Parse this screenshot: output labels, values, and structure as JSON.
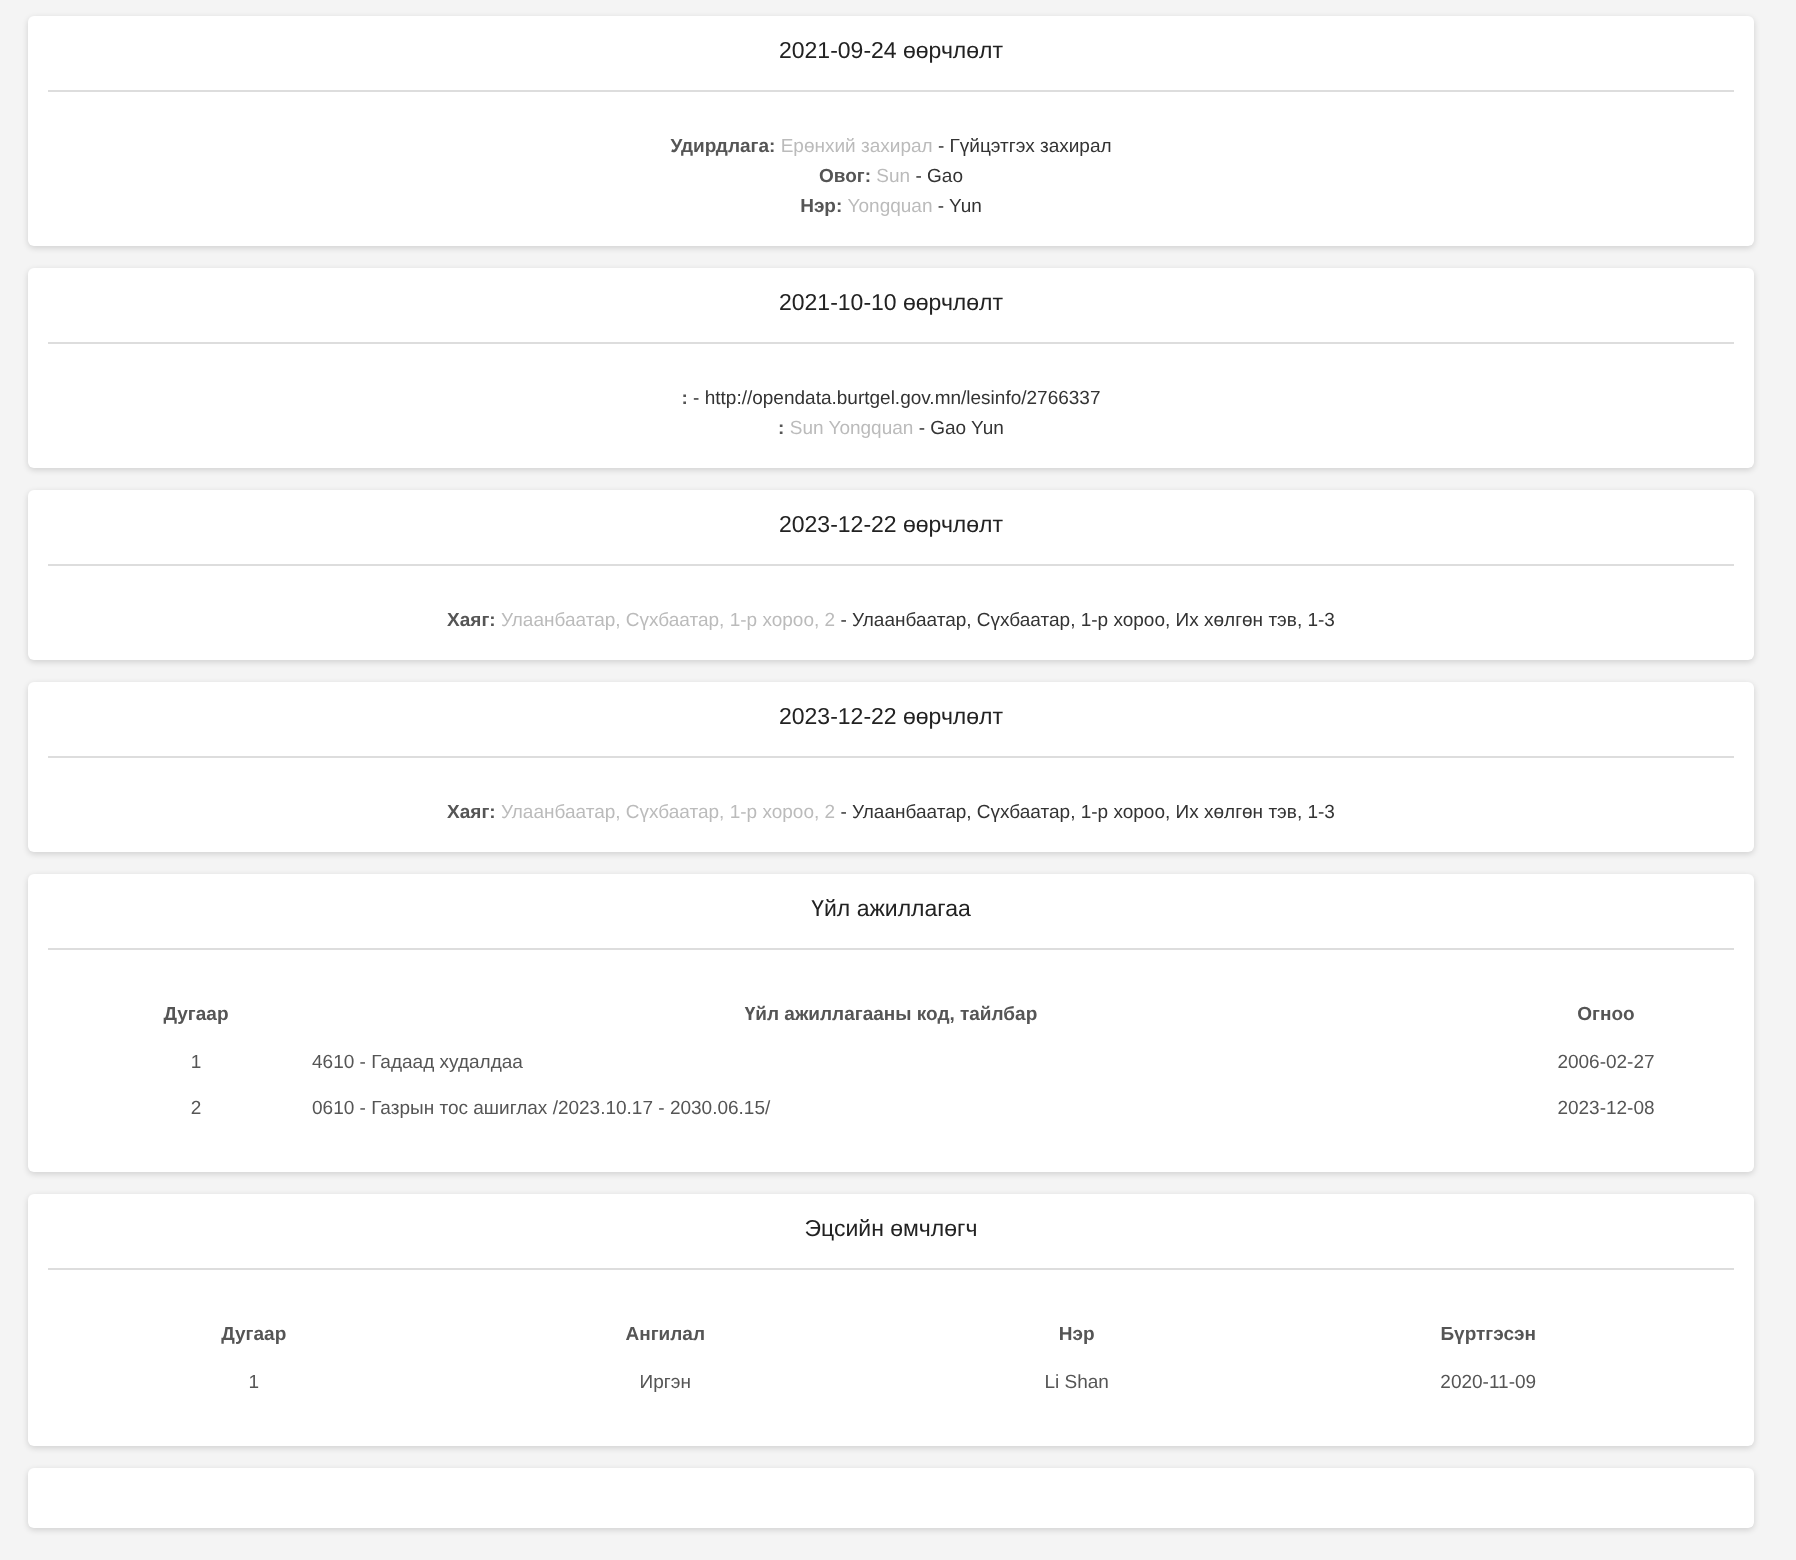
{
  "changes": [
    {
      "title": "2021-09-24 өөрчлөлт",
      "lines": [
        {
          "label": "Удирдлага:",
          "old": "Ерөнхий захирал",
          "new": "- Гүйцэтгэх захирал"
        },
        {
          "label": "Овог:",
          "old": "Sun",
          "new": "- Gao"
        },
        {
          "label": "Нэр:",
          "old": "Yongquan",
          "new": "- Yun"
        }
      ]
    },
    {
      "title": "2021-10-10 өөрчлөлт",
      "lines": [
        {
          "label": ":",
          "new": "- http://opendata.burtgel.gov.mn/lesinfo/2766337"
        },
        {
          "label": ":",
          "old": "Sun Yongquan",
          "new": "- Gao Yun"
        }
      ]
    },
    {
      "title": "2023-12-22 өөрчлөлт",
      "lines": [
        {
          "label": "Хаяг:",
          "old": "Улаанбаатар, Сүхбаатар, 1-р хороо, 2",
          "new": "- Улаанбаатар, Сүхбаатар, 1-р хороо, Их хөлгөн тэв, 1-3"
        }
      ]
    },
    {
      "title": "2023-12-22 өөрчлөлт",
      "lines": [
        {
          "label": "Хаяг:",
          "old": "Улаанбаатар, Сүхбаатар, 1-р хороо, 2",
          "new": "- Улаанбаатар, Сүхбаатар, 1-р хороо, Их хөлгөн тэв, 1-3"
        }
      ]
    }
  ],
  "activities": {
    "title": "Үйл ажиллагаа",
    "columns": [
      "Дугаар",
      "Үйл ажиллагааны код, тайлбар",
      "Огноо"
    ],
    "rows": [
      [
        "1",
        "4610 - Гадаад худалдаа",
        "2006-02-27"
      ],
      [
        "2",
        "0610 - Газрын тос ашиглах /2023.10.17 - 2030.06.15/",
        "2023-12-08"
      ]
    ]
  },
  "owners": {
    "title": "Эцсийн өмчлөгч",
    "columns": [
      "Дугаар",
      "Ангилал",
      "Нэр",
      "Бүртгэсэн"
    ],
    "rows": [
      [
        "1",
        "Иргэн",
        "Li Shan",
        "2020-11-09"
      ]
    ]
  }
}
